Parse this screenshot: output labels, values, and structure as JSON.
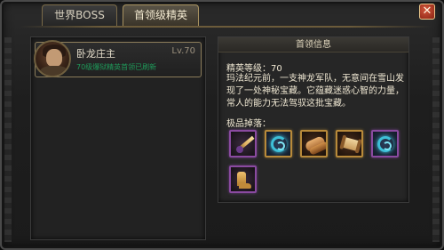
{
  "tabs": [
    {
      "label": "世界BOSS",
      "active": false
    },
    {
      "label": "首领级精英",
      "active": true
    }
  ],
  "close_icon": "close-x",
  "boss_list": [
    {
      "name": "卧龙庄主",
      "level": "Lv.70",
      "status": "70级爆狱精英首领已刷新",
      "avatar_icon": "warrior-portrait"
    }
  ],
  "info_panel": {
    "header": "首领信息",
    "elite_level": "精英等级：70",
    "lore": "玛法纪元前，一支神龙军队，无意间在雪山发现了一处神秘宝藏。它蕴藏迷惑心智的力量，常人的能力无法驾驭这批宝藏。",
    "drops_label": "极品掉落：",
    "drops": [
      {
        "icon": "staff-weapon-icon",
        "rarity": "purple"
      },
      {
        "icon": "swirl-orb-icon",
        "rarity": "gold"
      },
      {
        "icon": "scroll-roll-icon",
        "rarity": "gold"
      },
      {
        "icon": "scroll-parchment-icon",
        "rarity": "gold"
      },
      {
        "icon": "swirl-orb-icon",
        "rarity": "purple"
      },
      {
        "icon": "boot-icon",
        "rarity": "purple"
      }
    ]
  }
}
